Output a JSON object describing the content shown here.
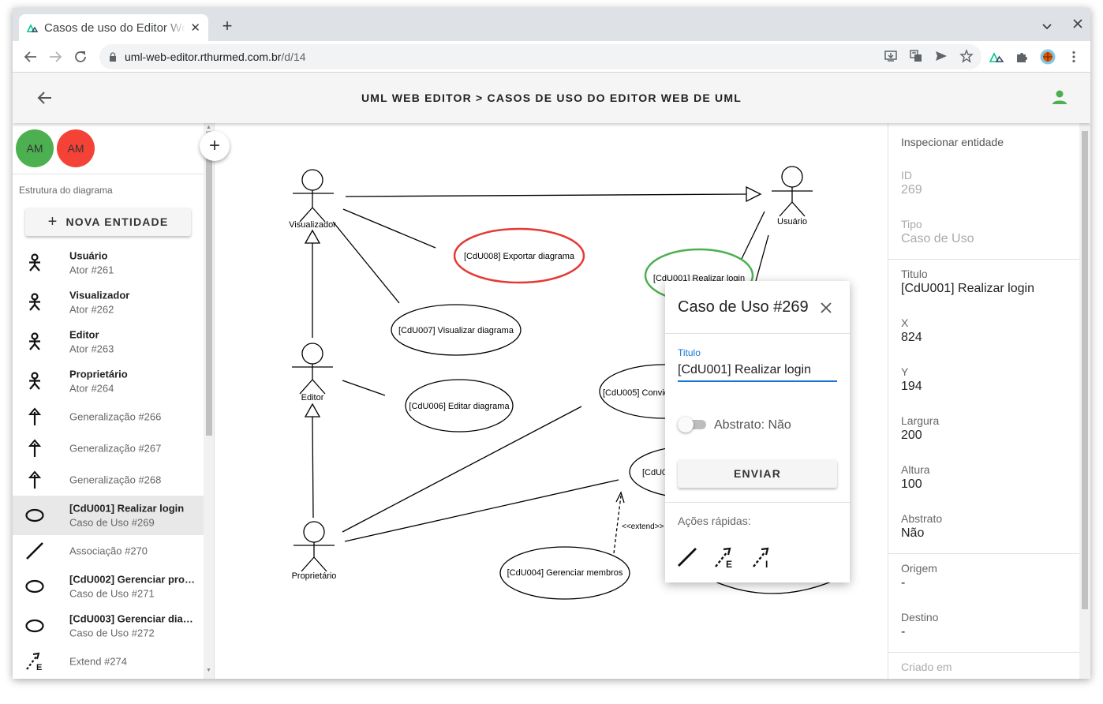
{
  "browser": {
    "tab_title": "Casos de uso do Editor Web de UML",
    "tab_close": "✕",
    "new_tab": "+",
    "url_host": "uml-web-editor.rthurmed.com.br",
    "url_path": "/d/14"
  },
  "appbar": {
    "title": "UML WEB EDITOR > CASOS DE USO DO EDITOR WEB DE UML",
    "back_icon": "arrow-left-icon",
    "user_icon": "account-icon",
    "user_color": "#4caf50"
  },
  "sidebar": {
    "avatars": [
      {
        "initials": "AM",
        "color": "#4caf50"
      },
      {
        "initials": "AM",
        "color": "#f44336"
      }
    ],
    "structure_label": "Estrutura do diagrama",
    "new_entity_label": "NOVA ENTIDADE",
    "items": [
      {
        "name": "Usuário",
        "sub": "Ator #261",
        "icon": "actor-icon"
      },
      {
        "name": "Visualizador",
        "sub": "Ator #262",
        "icon": "actor-icon"
      },
      {
        "name": "Editor",
        "sub": "Ator #263",
        "icon": "actor-icon"
      },
      {
        "name": "Proprietário",
        "sub": "Ator #264",
        "icon": "actor-icon"
      },
      {
        "name": "Generalização #266",
        "icon": "generalization-icon"
      },
      {
        "name": "Generalização #267",
        "icon": "generalization-icon"
      },
      {
        "name": "Generalização #268",
        "icon": "generalization-icon"
      },
      {
        "name": "[CdU001] Realizar login",
        "sub": "Caso de Uso #269",
        "icon": "usecase-icon",
        "selected": true
      },
      {
        "name": "Associação #270",
        "icon": "association-icon"
      },
      {
        "name": "[CdU002] Gerenciar proj…",
        "sub": "Caso de Uso #271",
        "icon": "usecase-icon"
      },
      {
        "name": "[CdU003] Gerenciar diag…",
        "sub": "Caso de Uso #272",
        "icon": "usecase-icon"
      },
      {
        "name": "Extend #274",
        "icon": "extend-icon"
      }
    ]
  },
  "canvas": {
    "add_button": "+",
    "actors": [
      "Visualizador",
      "Usuário",
      "Editor",
      "Proprietário"
    ],
    "usecases": [
      "[CdU008] Exportar diagrama",
      "[CdU001] Realizar login",
      "[CdU007] Visualizar diagrama",
      "[CdU006] Editar diagrama",
      "[CdU005] Convidar",
      "[CdU002]",
      "[CdU004] Gerenciar membros"
    ],
    "extend_label": "<<extend>>",
    "colors": {
      "selected": "#4caf50",
      "highlight": "#e53935"
    }
  },
  "popup": {
    "title": "Caso de Uso #269",
    "field_label": "Titulo",
    "field_value": "[CdU001] Realizar login",
    "toggle_label": "Abstrato: Não",
    "send_label": "ENVIAR",
    "quick_actions_label": "Ações rápidas:",
    "quick_actions": [
      "association-icon",
      "extend-icon",
      "include-icon"
    ]
  },
  "inspector": {
    "title": "Inspecionar entidade",
    "fields": [
      {
        "label": "ID",
        "value": "269"
      },
      {
        "label": "Tipo",
        "value": "Caso de Uso"
      },
      {
        "label": "Titulo",
        "value": "[CdU001] Realizar login"
      },
      {
        "label": "X",
        "value": "824"
      },
      {
        "label": "Y",
        "value": "194"
      },
      {
        "label": "Largura",
        "value": "200"
      },
      {
        "label": "Altura",
        "value": "100"
      },
      {
        "label": "Abstrato",
        "value": "Não"
      },
      {
        "label": "Origem",
        "value": "-"
      },
      {
        "label": "Destino",
        "value": "-"
      },
      {
        "label": "Criado em",
        "value": ""
      }
    ]
  }
}
